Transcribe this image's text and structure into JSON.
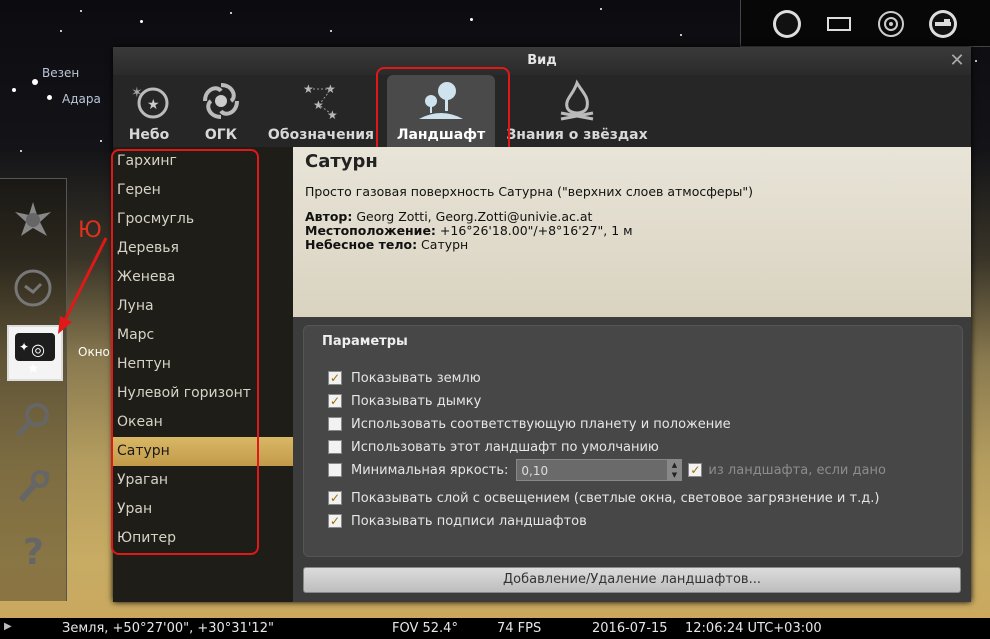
{
  "sky": {
    "labels": [
      "Везен",
      "Адара"
    ],
    "window_hint": "Окно",
    "annotation_letter": "Ю"
  },
  "top_toolbar": {
    "icons": [
      "planet-icon",
      "frame-icon",
      "target-icon",
      "telescope-icon"
    ]
  },
  "left_toolbar": {
    "icons": [
      "location-icon",
      "clock-icon",
      "view-window-icon",
      "search-icon",
      "settings-icon",
      "help-icon"
    ]
  },
  "dialog": {
    "title": "Вид",
    "tabs": [
      {
        "label": "Небо",
        "icon": "sky-icon"
      },
      {
        "label": "ОГК",
        "icon": "dso-icon"
      },
      {
        "label": "Обозначения",
        "icon": "markings-icon"
      },
      {
        "label": "Ландшафт",
        "icon": "landscape-icon",
        "active": true
      },
      {
        "label": "Знания о звёздах",
        "icon": "starlore-icon"
      }
    ],
    "landscapes": [
      "Гархинг",
      "Герен",
      "Гросмугль",
      "Деревья",
      "Женева",
      "Луна",
      "Марс",
      "Нептун",
      "Нулевой горизонт",
      "Океан",
      "Сатурн",
      "Ураган",
      "Уран",
      "Юпитер"
    ],
    "selected": "Сатурн",
    "description": {
      "title": "Сатурн",
      "text": "Просто газовая поверхность Сатурна (\"верхних слоев атмосферы\")",
      "author_label": "Автор:",
      "author_value": " Georg Zotti, Georg.Zotti@univie.ac.at",
      "location_label": "Местоположение:",
      "location_value": " +16°26'18.00\"/+8°16'27\", 1 м",
      "body_label": "Небесное тело:",
      "body_value": " Сатурн"
    },
    "params": {
      "title": "Параметры",
      "show_ground": "Показывать землю",
      "show_fog": "Показывать дымку",
      "use_planet": "Использовать соответствующую планету и положение",
      "use_default": "Использовать этот ландшафт по умолчанию",
      "min_brightness": "Минимальная яркость:",
      "min_brightness_value": "0,10",
      "from_landscape": "из ландшафта, если дано",
      "show_illum": "Показывать слой с освещением (светлые окна, световое загрязнение и т.д.)",
      "show_labels": "Показывать подписи ландшафтов",
      "checked": {
        "show_ground": true,
        "show_fog": true,
        "use_planet": false,
        "use_default": false,
        "min_brightness": false,
        "from_landscape": true,
        "show_illum": true,
        "show_labels": true
      }
    },
    "add_remove_button": "Добавление/Удаление ландшафтов..."
  },
  "status": {
    "location": "Земля, +50°27'00\", +30°31'12\"",
    "fov": "FOV 52.4°",
    "fps": "74 FPS",
    "date": "2016-07-15",
    "time": "12:06:24 UTC+03:00"
  },
  "colors": {
    "highlight": "#e01818",
    "selection": "#d9b866",
    "check": "#9a6d00"
  }
}
